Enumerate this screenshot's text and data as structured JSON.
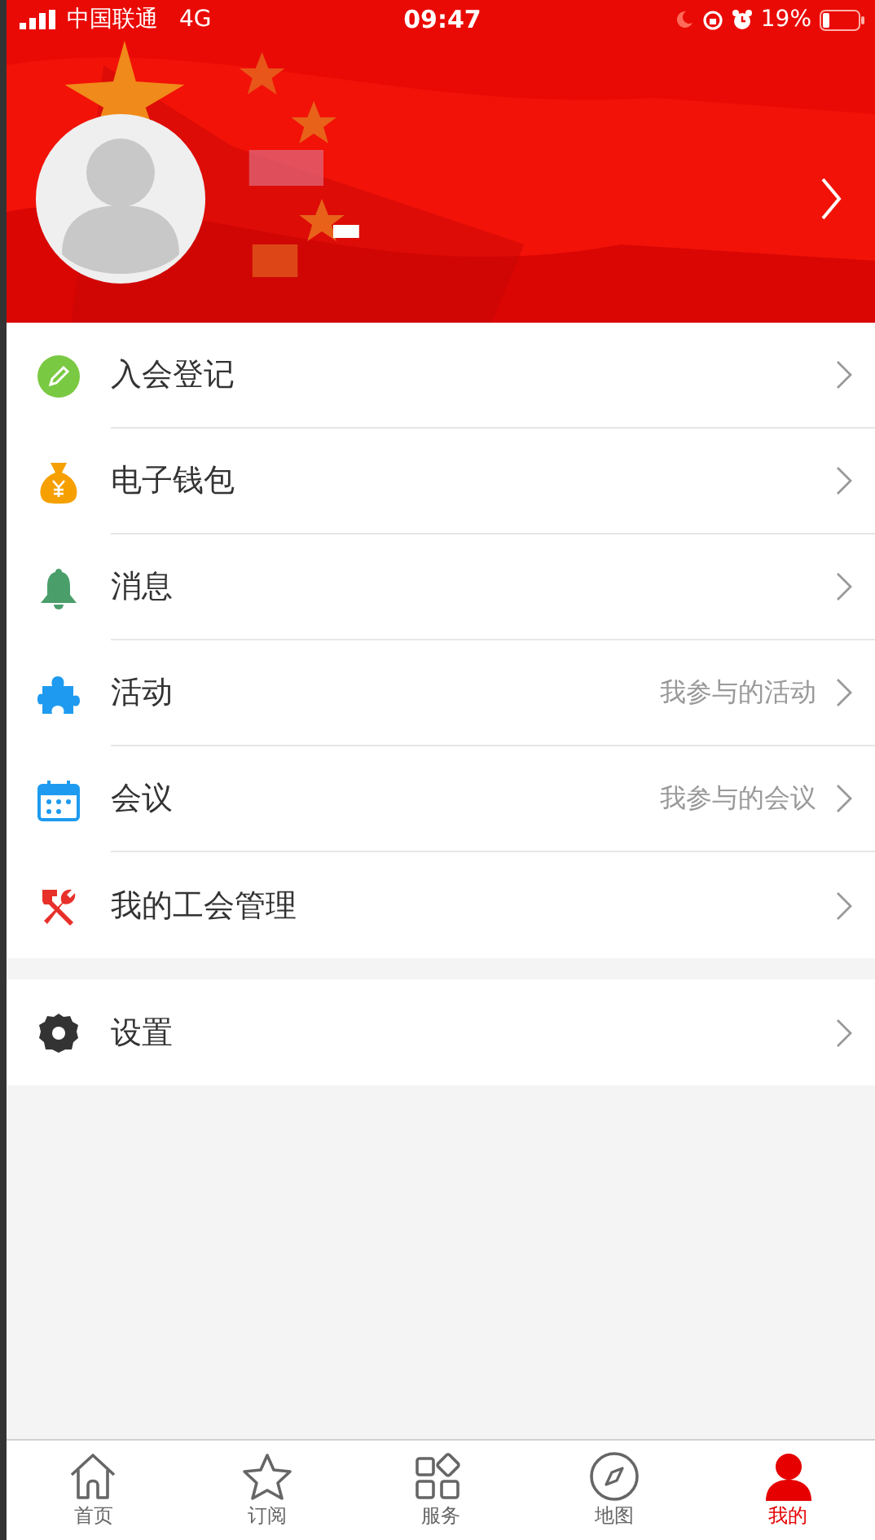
{
  "status_bar": {
    "carrier": "中国联通",
    "network": "4G",
    "time": "09:47",
    "battery": "19%"
  },
  "menu_sections": [
    {
      "items": [
        {
          "label": "入会登记"
        },
        {
          "label": "电子钱包"
        },
        {
          "label": "消息"
        },
        {
          "label": "活动",
          "note": "我参与的活动"
        },
        {
          "label": "会议",
          "note": "我参与的会议"
        },
        {
          "label": "我的工会管理"
        }
      ]
    },
    {
      "items": [
        {
          "label": "设置"
        }
      ]
    }
  ],
  "tab_bar": [
    {
      "label": "首页",
      "selected": false
    },
    {
      "label": "订阅",
      "selected": false
    },
    {
      "label": "服务",
      "selected": false
    },
    {
      "label": "地图",
      "selected": false
    },
    {
      "label": "我的",
      "selected": true
    }
  ]
}
